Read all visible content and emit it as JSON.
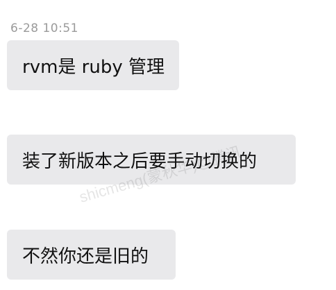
{
  "timestamp": "6-28 10:51",
  "messages": [
    {
      "text": "rvm是 ruby 管理"
    },
    {
      "text": "装了新版本之后要手动切换的"
    },
    {
      "text": "不然你还是旧的"
    }
  ],
  "watermark": "shicmeng(蒙秋华)@腾讯"
}
